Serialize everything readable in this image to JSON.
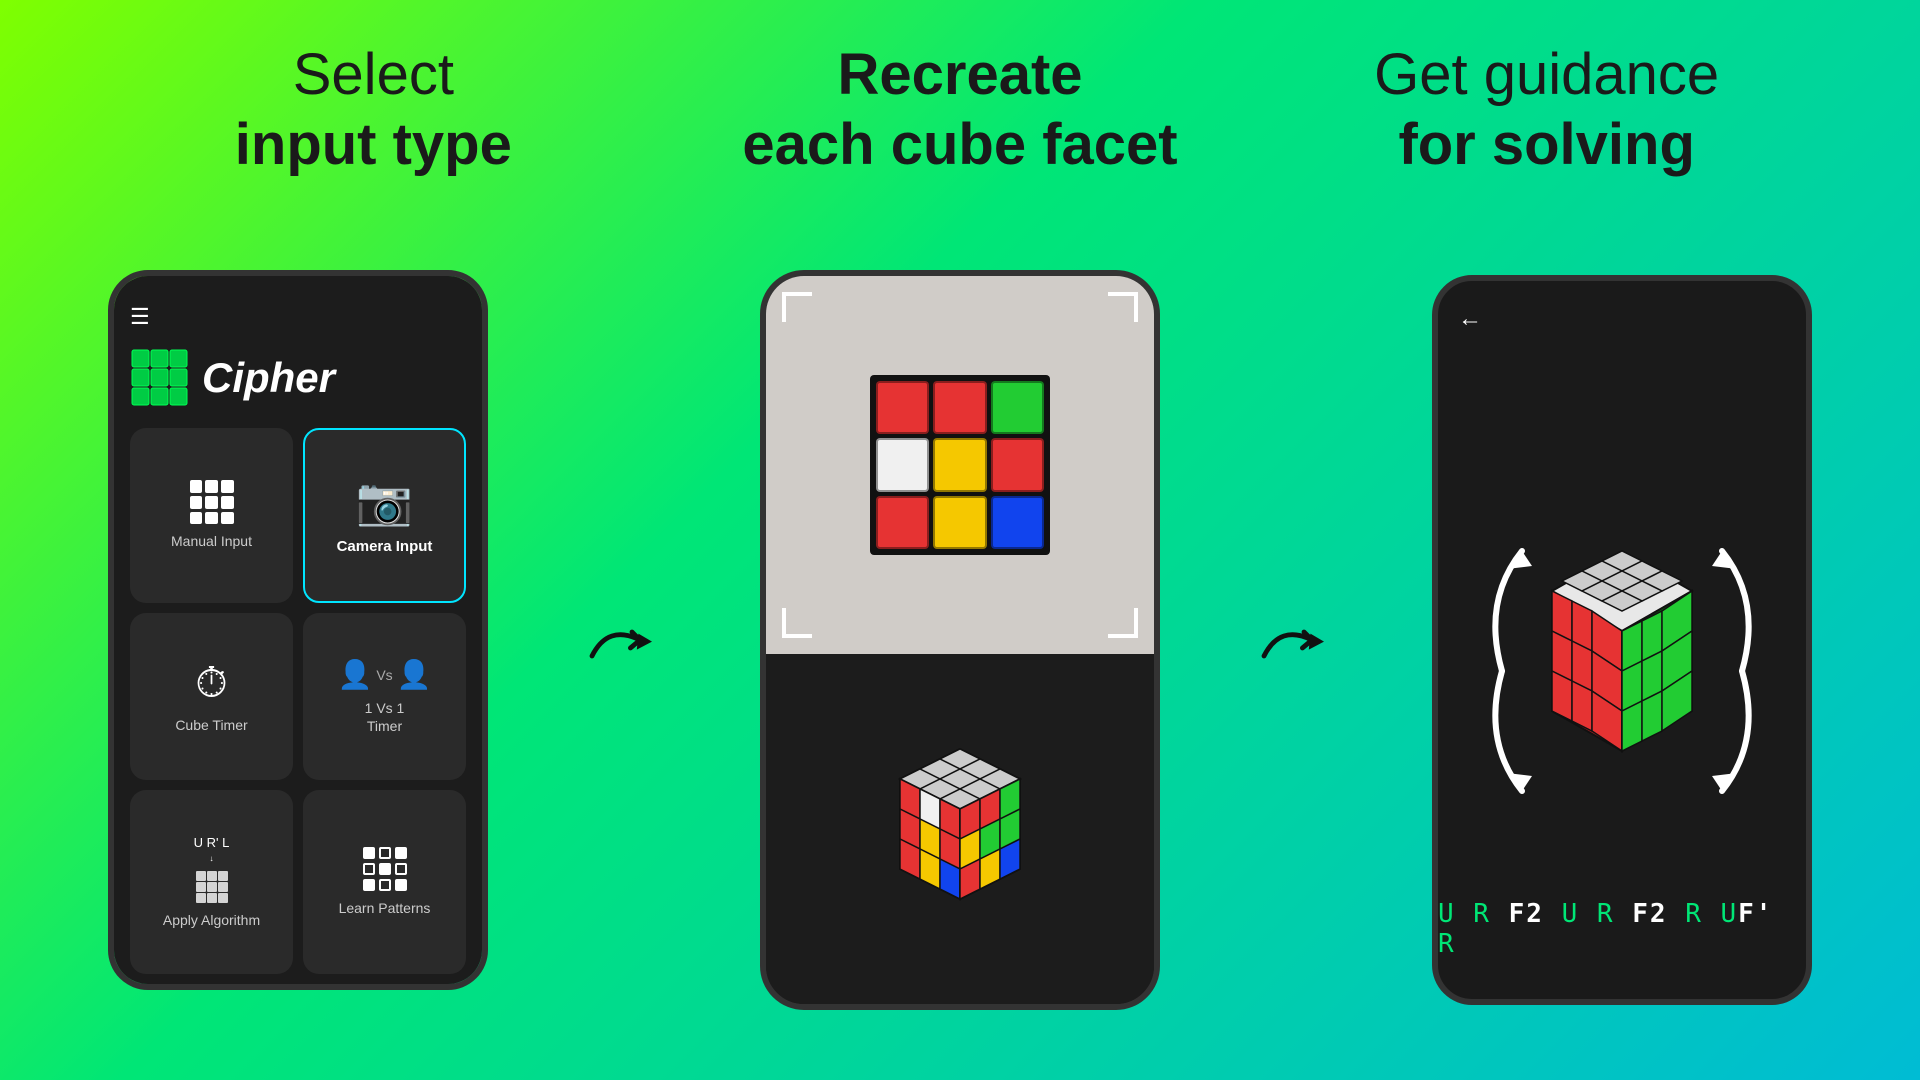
{
  "headers": [
    {
      "line1": "Select",
      "line2_bold": "input type"
    },
    {
      "line1_bold": "Recreate",
      "line2": "each cube facet"
    },
    {
      "line1": "Get guidance",
      "line2_bold": "for solving"
    }
  ],
  "phone1": {
    "appName": "Cipher",
    "buttons": [
      {
        "label": "Manual Input",
        "type": "grid"
      },
      {
        "label": "Camera Input",
        "type": "camera",
        "highlighted": true
      },
      {
        "label": "Cube Timer",
        "type": "timer"
      },
      {
        "label": "1 Vs 1\nTimer",
        "type": "vs"
      },
      {
        "label": "Apply Algorithm",
        "type": "algo"
      },
      {
        "label": "Learn Patterns",
        "type": "patterns"
      }
    ]
  },
  "phone3": {
    "solutionText": "U R F2 U R F2 R U F' R"
  },
  "cubeColors": {
    "photo": [
      "red",
      "red",
      "green",
      "white",
      "yellow",
      "red",
      "red",
      "yellow",
      "blue"
    ],
    "model": [
      "red",
      "red",
      "green",
      "white",
      "yellow",
      "red",
      "red",
      "yellow",
      "blue"
    ]
  }
}
